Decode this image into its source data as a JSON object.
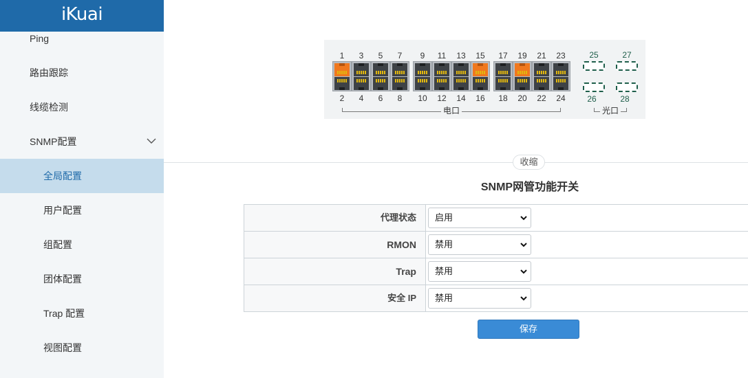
{
  "brand": {
    "logo": "iKuai",
    "color": "#1f6aa9"
  },
  "sidebar": {
    "items": [
      {
        "label": "Ping"
      },
      {
        "label": "路由跟踪"
      },
      {
        "label": "线缆检测"
      },
      {
        "label": "SNMP配置",
        "expanded": true,
        "icon": "chevron-down-icon"
      },
      {
        "label": "全局配置",
        "active": true
      },
      {
        "label": "用户配置"
      },
      {
        "label": "组配置"
      },
      {
        "label": "团体配置"
      },
      {
        "label": "Trap 配置"
      },
      {
        "label": "视图配置"
      }
    ]
  },
  "ports": {
    "electric_label": "电口",
    "fiber_label": "光口",
    "top_numbers": [
      "1",
      "3",
      "5",
      "7",
      "9",
      "11",
      "13",
      "15",
      "17",
      "19",
      "21",
      "23"
    ],
    "bottom_numbers": [
      "2",
      "4",
      "6",
      "8",
      "10",
      "12",
      "14",
      "16",
      "18",
      "20",
      "22",
      "24"
    ],
    "fiber_top": [
      "25",
      "27"
    ],
    "fiber_bottom": [
      "26",
      "28"
    ],
    "active_ports": [
      "1",
      "15",
      "19"
    ],
    "active_color": "#f0781e"
  },
  "collapse_label": "收缩",
  "form": {
    "title": "SNMP网管功能开关",
    "rows": [
      {
        "label": "代理状态",
        "value": "启用"
      },
      {
        "label": "RMON",
        "value": "禁用"
      },
      {
        "label": "Trap",
        "value": "禁用"
      },
      {
        "label": "安全 IP",
        "value": "禁用"
      }
    ],
    "save_label": "保存",
    "save_color": "#3a8bd6"
  }
}
